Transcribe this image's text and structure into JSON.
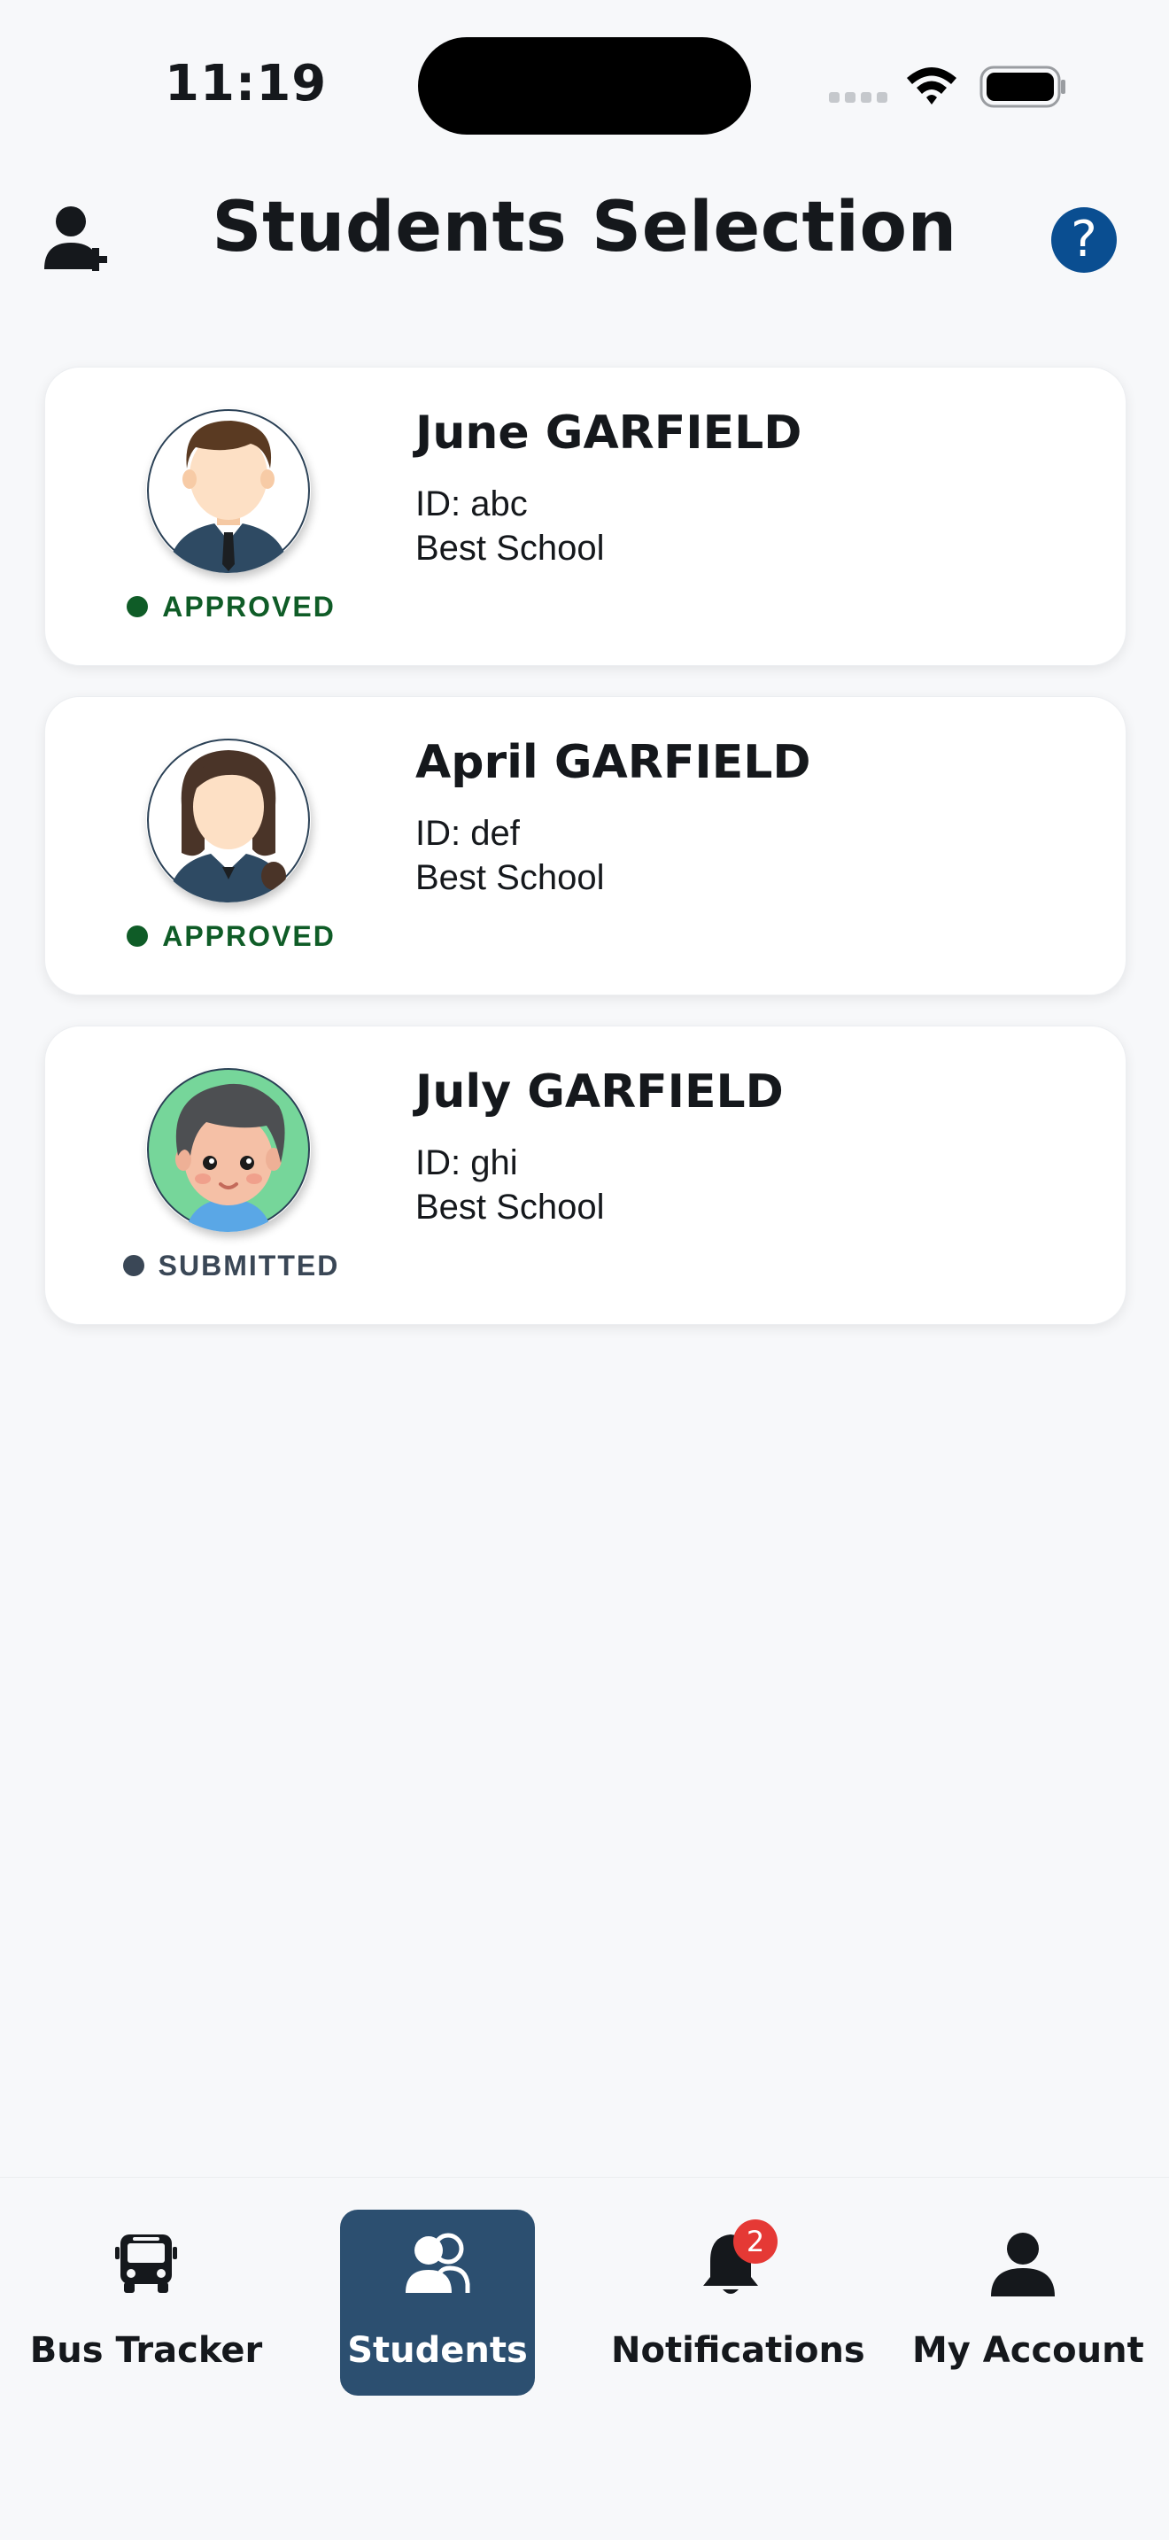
{
  "status_bar": {
    "time": "11:19"
  },
  "header": {
    "title": "Students Selection",
    "help_label": "?",
    "add_icon": "person-add-icon"
  },
  "students": [
    {
      "name": "June GARFIELD",
      "id": "ID: abc",
      "school": "Best School",
      "status": "APPROVED",
      "status_color": "#0f5c27"
    },
    {
      "name": "April GARFIELD",
      "id": "ID: def",
      "school": "Best School",
      "status": "APPROVED",
      "status_color": "#0f5c27"
    },
    {
      "name": "July GARFIELD",
      "id": "ID: ghi",
      "school": "Best School",
      "status": "SUBMITTED",
      "status_color": "#3a4756"
    }
  ],
  "nav": {
    "items": [
      {
        "label": "Bus Tracker",
        "icon": "bus-icon"
      },
      {
        "label": "Students",
        "icon": "students-icon",
        "active": true
      },
      {
        "label": "Notifications",
        "icon": "bell-icon",
        "badge": "2"
      },
      {
        "label": "My Account",
        "icon": "account-icon"
      }
    ]
  },
  "colors": {
    "accent": "#2c4f70",
    "help": "#0a4e91",
    "badge": "#e53935",
    "background": "#f7f8fa"
  }
}
